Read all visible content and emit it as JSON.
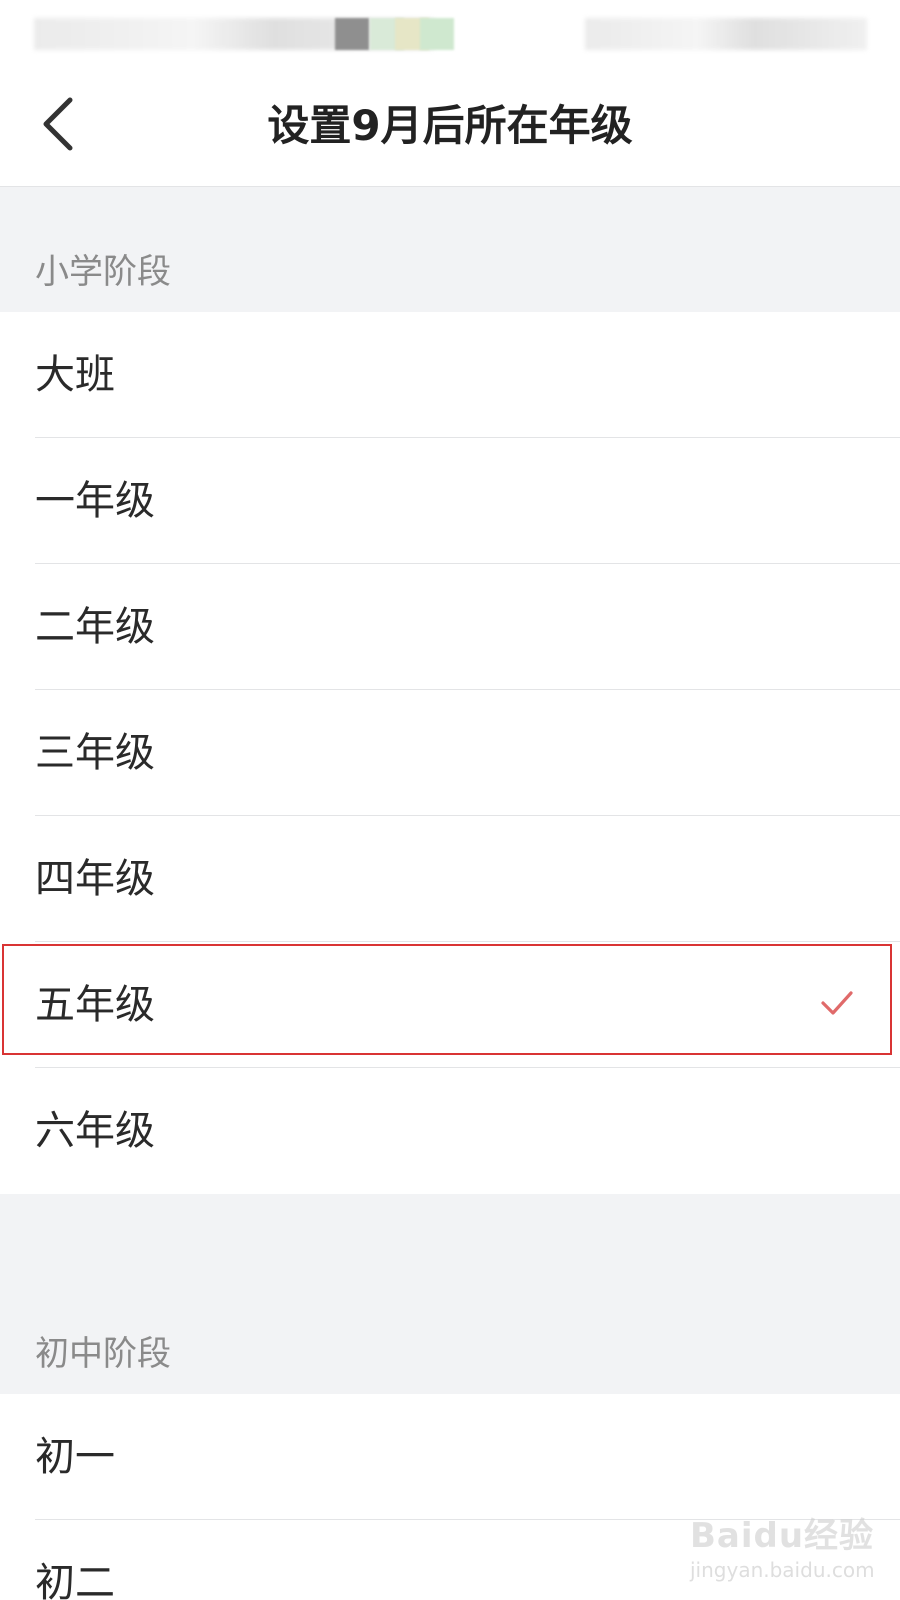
{
  "nav": {
    "title": "设置9月后所在年级"
  },
  "sections": [
    {
      "title": "小学阶段",
      "items": [
        {
          "label": "大班"
        },
        {
          "label": "一年级"
        },
        {
          "label": "二年级"
        },
        {
          "label": "三年级"
        },
        {
          "label": "四年级"
        },
        {
          "label": "五年级",
          "selected": true
        },
        {
          "label": "六年级"
        }
      ]
    },
    {
      "title": "初中阶段",
      "items": [
        {
          "label": "初一"
        },
        {
          "label": "初二"
        }
      ]
    }
  ],
  "watermark": {
    "logo": "Baidu经验",
    "url": "jingyan.baidu.com"
  },
  "colors": {
    "accent_check": "#e06a6a",
    "highlight_border": "#d93434",
    "section_bg": "#f2f3f5"
  },
  "icons": {
    "back": "chevron-left-icon",
    "selected": "check-icon"
  }
}
